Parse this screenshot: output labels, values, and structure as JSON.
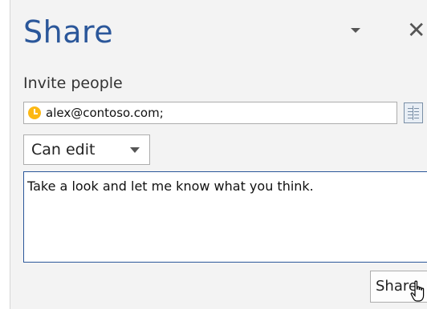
{
  "panel": {
    "title": "Share"
  },
  "header": {
    "dropdown_icon": "chevron-down-icon",
    "close_glyph": "✕"
  },
  "invite": {
    "label": "Invite people",
    "value": "alex@contoso.com;",
    "presence_color": "#fcb814",
    "address_book_icon": "address-book-icon"
  },
  "permission": {
    "selected": "Can edit"
  },
  "message": {
    "value": "Take a look and let me know what you think."
  },
  "actions": {
    "share_label": "Share"
  },
  "colors": {
    "accent": "#2b579a",
    "pane_background": "#f3f3f3",
    "presence": "#fcb814"
  }
}
